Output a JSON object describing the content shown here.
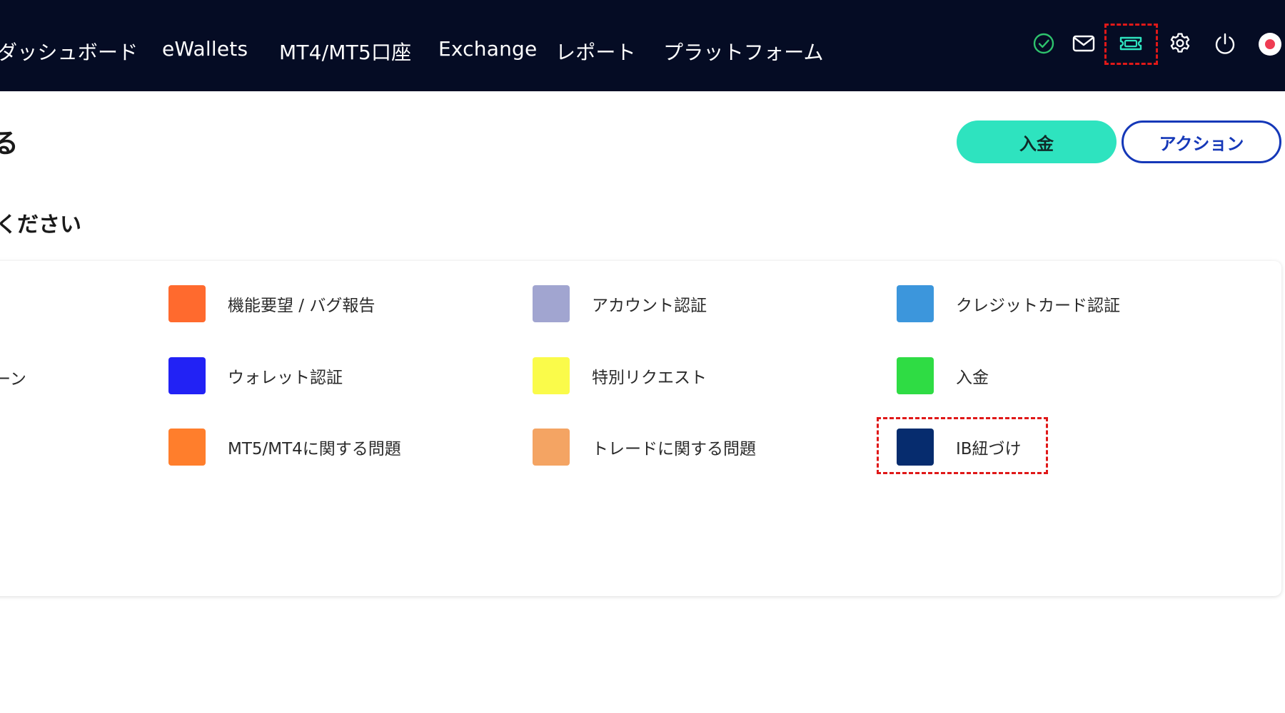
{
  "nav": {
    "items": [
      {
        "key": "dashboard",
        "label": "ダッシュボード"
      },
      {
        "key": "ewallets",
        "label": "eWallets"
      },
      {
        "key": "mt",
        "label": "MT4/MT5口座"
      },
      {
        "key": "exchange",
        "label": "Exchange"
      },
      {
        "key": "report",
        "label": "レポート"
      },
      {
        "key": "platform",
        "label": "プラットフォーム"
      }
    ],
    "icons": [
      "verified-check-icon",
      "mail-icon",
      "ticket-icon",
      "gear-icon",
      "power-icon",
      "avatar"
    ],
    "highlighted_icon": "ticket-icon"
  },
  "header": {
    "title": "る",
    "deposit_button": "入金",
    "action_button": "アクション"
  },
  "section": {
    "title": "ください"
  },
  "categories": [
    {
      "label": "機能要望 / バグ報告",
      "color": "#ff6a2e"
    },
    {
      "label": "アカウント認証",
      "color": "#a1a5d0"
    },
    {
      "label": "クレジットカード認証",
      "color": "#3c96dc"
    },
    {
      "label": "ーン",
      "color": null
    },
    {
      "label": "ウォレット認証",
      "color": "#2222f5"
    },
    {
      "label": "特別リクエスト",
      "color": "#fafb4a"
    },
    {
      "label": "入金",
      "color": "#2fdc44"
    },
    {
      "label": "MT5/MT4に関する問題",
      "color": "#ff7e2c"
    },
    {
      "label": "トレードに関する問題",
      "color": "#f4a463"
    },
    {
      "label": "IB紐づけ",
      "color": "#062c6e"
    }
  ],
  "highlighted_category": "IB紐づけ",
  "colors": {
    "topbar": "#050c24",
    "accent": "#2ee3bf",
    "primary": "#1538b8",
    "highlight": "#e01818"
  }
}
